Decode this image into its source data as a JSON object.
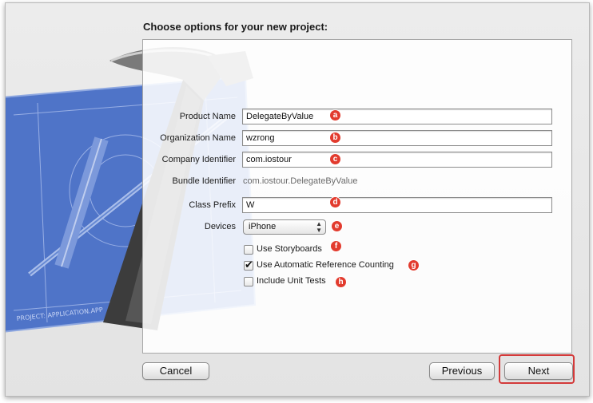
{
  "dialog": {
    "title": "Choose options for your new project:",
    "fields": {
      "product_name": {
        "label": "Product Name",
        "value": "DelegateByValue",
        "badge": "a"
      },
      "organization_name": {
        "label": "Organization Name",
        "value": "wzrong",
        "badge": "b"
      },
      "company_identifier": {
        "label": "Company Identifier",
        "value": "com.iostour",
        "badge": "c"
      },
      "bundle_identifier": {
        "label": "Bundle Identifier",
        "value": "com.iostour.DelegateByValue"
      },
      "class_prefix": {
        "label": "Class Prefix",
        "value": "W",
        "badge": "d"
      },
      "devices": {
        "label": "Devices",
        "value": "iPhone",
        "badge": "e"
      }
    },
    "checkboxes": {
      "storyboards": {
        "label": "Use Storyboards",
        "checked": false,
        "badge": "f"
      },
      "arc": {
        "label": "Use Automatic Reference Counting",
        "checked": true,
        "badge": "g"
      },
      "unit_tests": {
        "label": "Include Unit Tests",
        "checked": false,
        "badge": "h"
      }
    },
    "buttons": {
      "cancel": "Cancel",
      "previous": "Previous",
      "next": "Next"
    },
    "colors": {
      "annotation_badge": "#e23b2e",
      "highlight_border": "#d33a3a",
      "blueprint": "#4f74c8"
    }
  },
  "artwork": {
    "icons": [
      "hammer-icon",
      "blueprint-icon"
    ],
    "blueprint_caption": "PROJECT: APPLICATION.APP"
  }
}
